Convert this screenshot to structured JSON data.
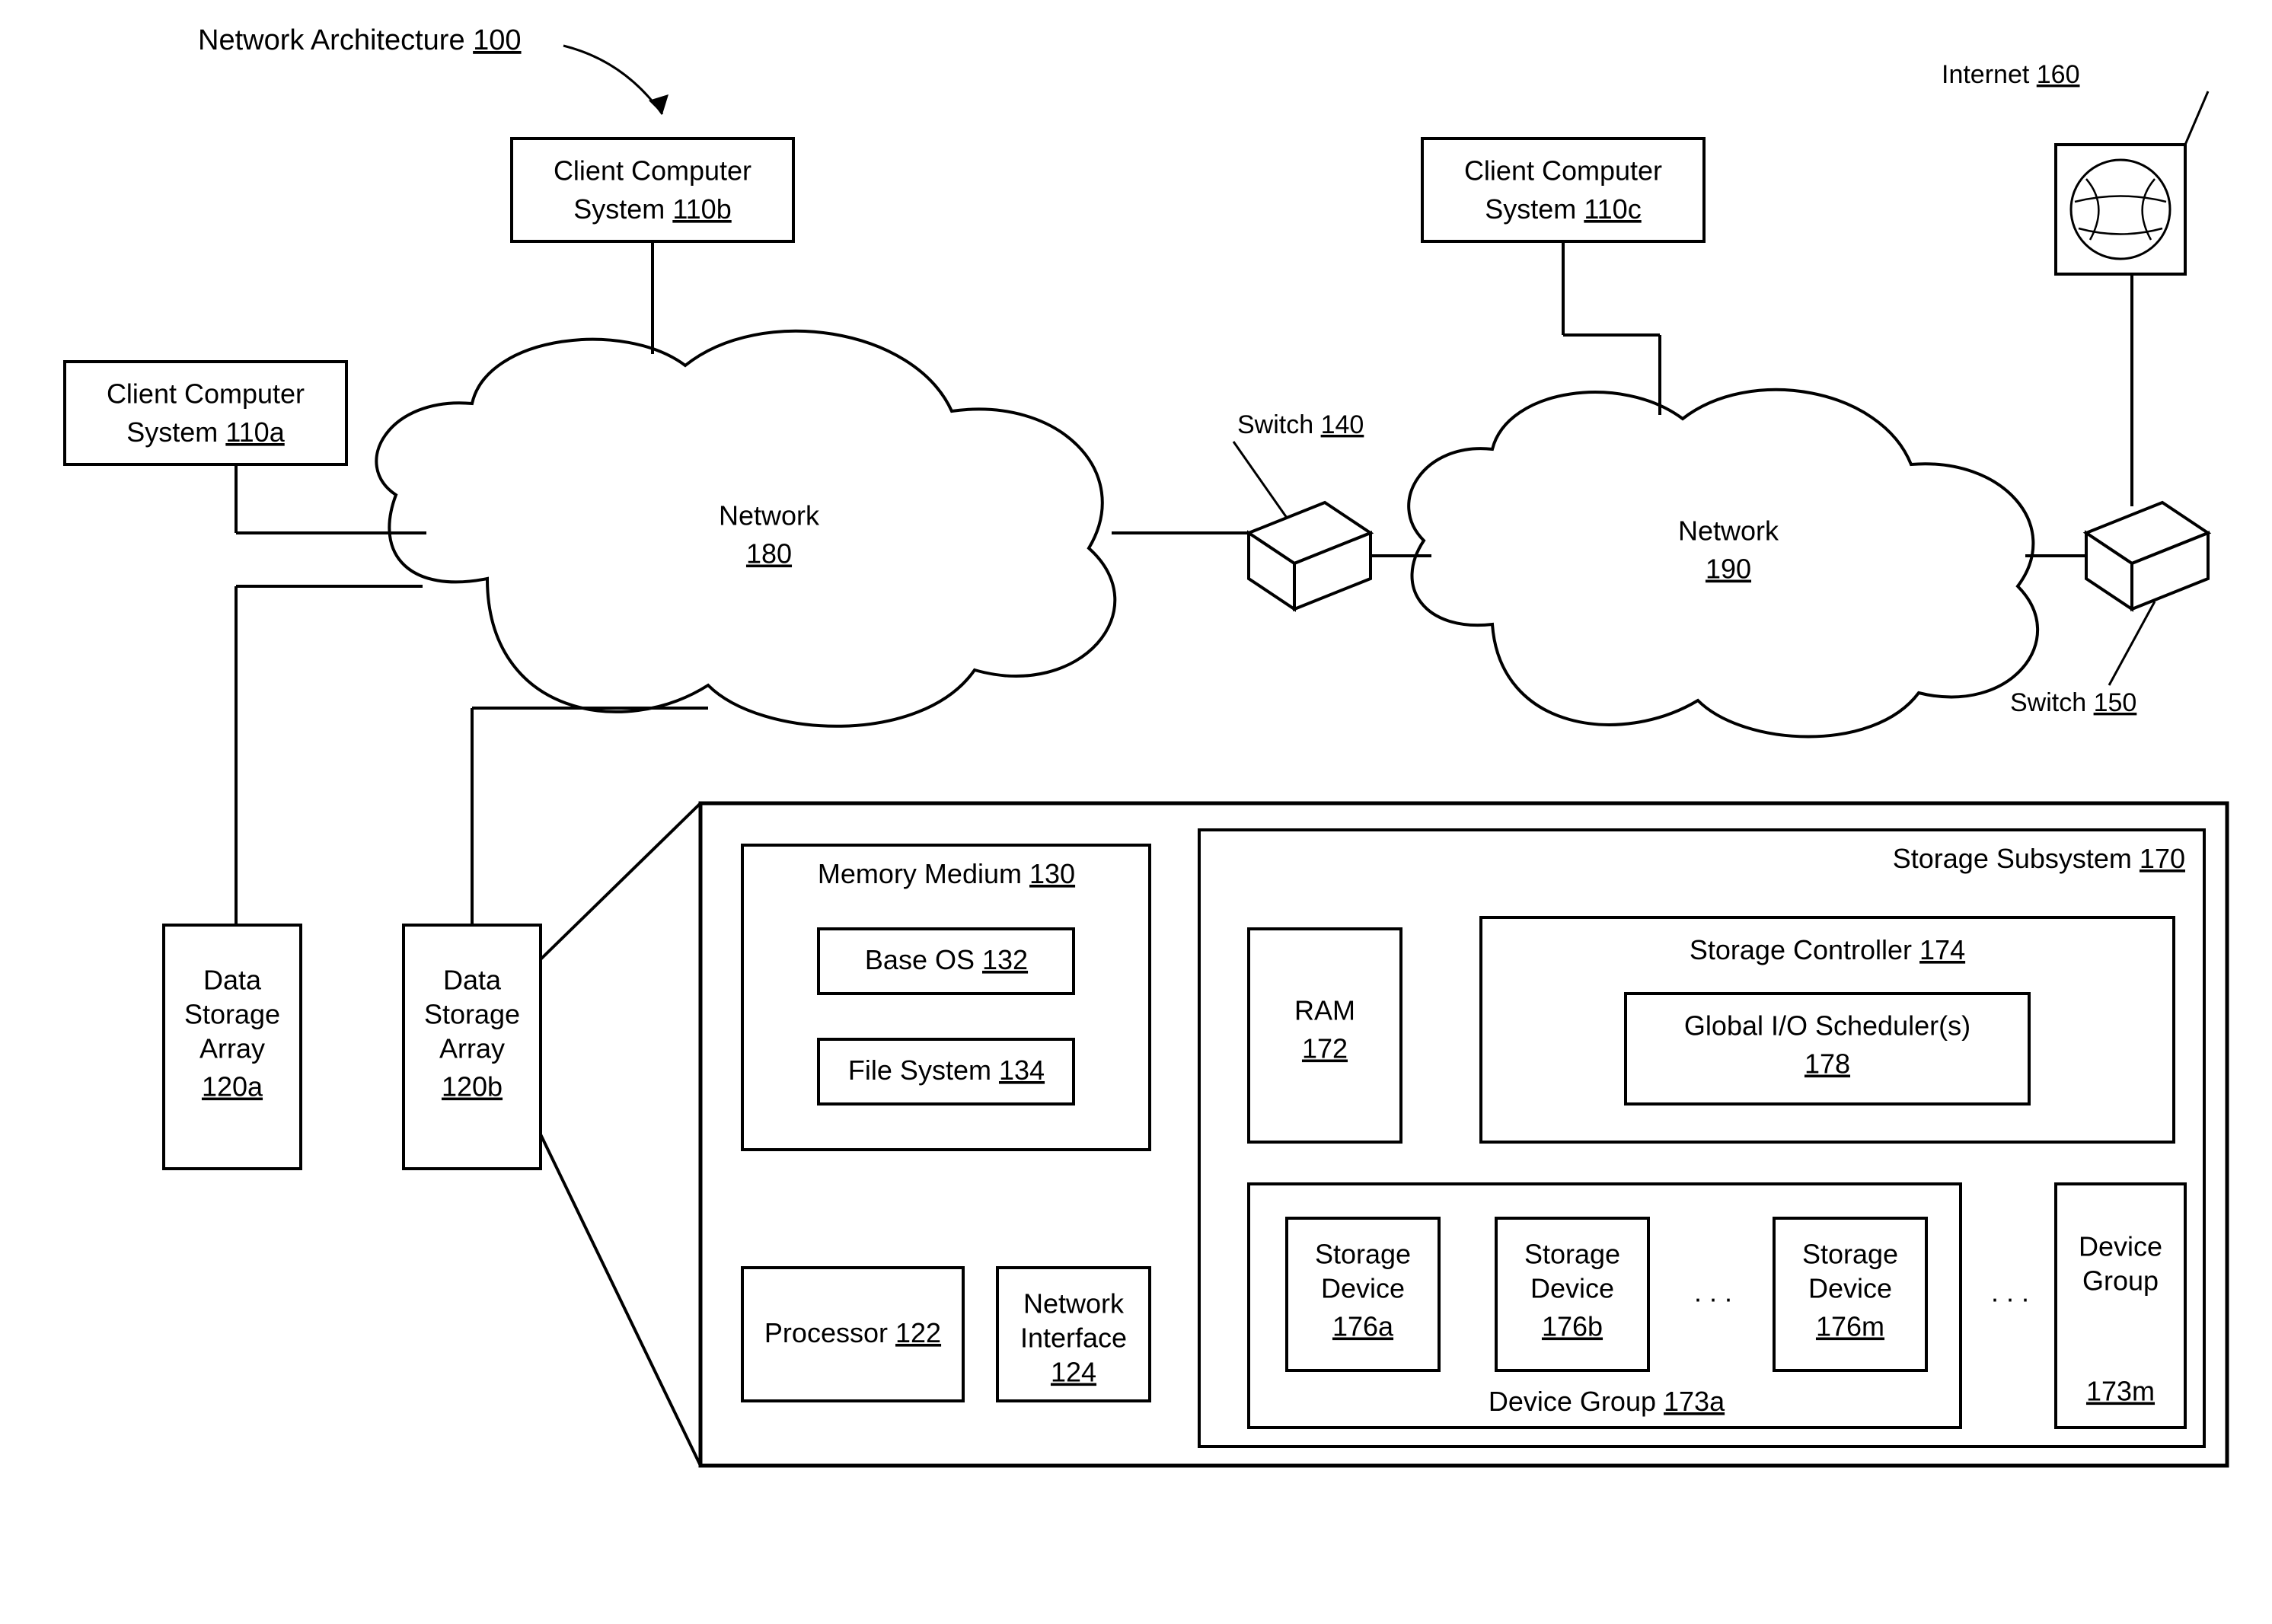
{
  "title": {
    "text": "Network Architecture",
    "num": "100"
  },
  "client_a": {
    "line1": "Client Computer",
    "line2": "System",
    "num": "110a"
  },
  "client_b": {
    "line1": "Client Computer",
    "line2": "System",
    "num": "110b"
  },
  "client_c": {
    "line1": "Client Computer",
    "line2": "System",
    "num": "110c"
  },
  "net180": {
    "text": "Network",
    "num": "180"
  },
  "net190": {
    "text": "Network",
    "num": "190"
  },
  "switch140": {
    "text": "Switch",
    "num": "140"
  },
  "switch150": {
    "text": "Switch",
    "num": "150"
  },
  "internet": {
    "text": "Internet",
    "num": "160"
  },
  "dsa_a": {
    "l1": "Data",
    "l2": "Storage",
    "l3": "Array",
    "num": "120a"
  },
  "dsa_b": {
    "l1": "Data",
    "l2": "Storage",
    "l3": "Array",
    "num": "120b"
  },
  "mem": {
    "text": "Memory Medium",
    "num": "130"
  },
  "baseos": {
    "text": "Base OS",
    "num": "132"
  },
  "fs": {
    "text": "File System",
    "num": "134"
  },
  "proc": {
    "text": "Processor",
    "num": "122"
  },
  "nif": {
    "l1": "Network",
    "l2": "Interface",
    "num": "124"
  },
  "sss": {
    "text": "Storage Subsystem",
    "num": "170"
  },
  "ram": {
    "text": "RAM",
    "num": "172"
  },
  "sctrl": {
    "text": "Storage Controller",
    "num": "174"
  },
  "gio": {
    "text": "Global I/O Scheduler(s)",
    "num": "178"
  },
  "sd_a": {
    "l1": "Storage",
    "l2": "Device",
    "num": "176a"
  },
  "sd_b": {
    "l1": "Storage",
    "l2": "Device",
    "num": "176b"
  },
  "sd_m": {
    "l1": "Storage",
    "l2": "Device",
    "num": "176m"
  },
  "dg_a": {
    "text": "Device Group",
    "num": "173a"
  },
  "dg_m": {
    "l1": "Device",
    "l2": "Group",
    "num": "173m"
  },
  "ellipsis": ".  .  ."
}
